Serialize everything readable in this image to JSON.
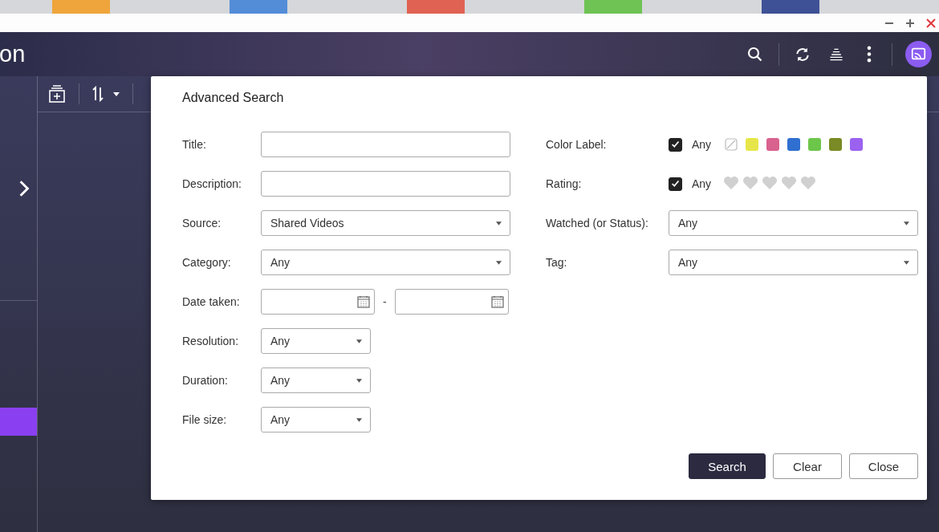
{
  "app": {
    "title": "on"
  },
  "dialog": {
    "title": "Advanced Search",
    "left_fields": [
      {
        "label": "Title:",
        "kind": "text"
      },
      {
        "label": "Description:",
        "kind": "text"
      },
      {
        "label": "Source:",
        "kind": "select",
        "value": "Shared Videos"
      },
      {
        "label": "Category:",
        "kind": "select",
        "value": "Any"
      },
      {
        "label": "Date taken:",
        "kind": "date_range",
        "separator": "-"
      },
      {
        "label": "Resolution:",
        "kind": "small_select",
        "value": "Any"
      },
      {
        "label": "Duration:",
        "kind": "small_select",
        "value": "Any"
      },
      {
        "label": "File size:",
        "kind": "small_select",
        "value": "Any"
      }
    ],
    "color_label": {
      "label": "Color Label:",
      "any_label": "Any",
      "any_checked": true,
      "colors": [
        {
          "kind": "none"
        },
        {
          "kind": "swatch",
          "color": "#e6e64a"
        },
        {
          "kind": "swatch",
          "color": "#d9628f"
        },
        {
          "kind": "swatch",
          "color": "#2f6fd0"
        },
        {
          "kind": "swatch",
          "color": "#6cc64a"
        },
        {
          "kind": "swatch",
          "color": "#7a8a24"
        },
        {
          "kind": "swatch",
          "color": "#9b62f0"
        }
      ]
    },
    "rating": {
      "label": "Rating:",
      "any_label": "Any",
      "any_checked": true,
      "stars": 0
    },
    "right_selects": [
      {
        "label": "Watched (or Status):",
        "value": "Any"
      },
      {
        "label": "Tag:",
        "value": "Any"
      }
    ],
    "buttons": [
      {
        "label": "Search",
        "primary": true
      },
      {
        "label": "Clear",
        "primary": false
      },
      {
        "label": "Close",
        "primary": false
      }
    ]
  }
}
